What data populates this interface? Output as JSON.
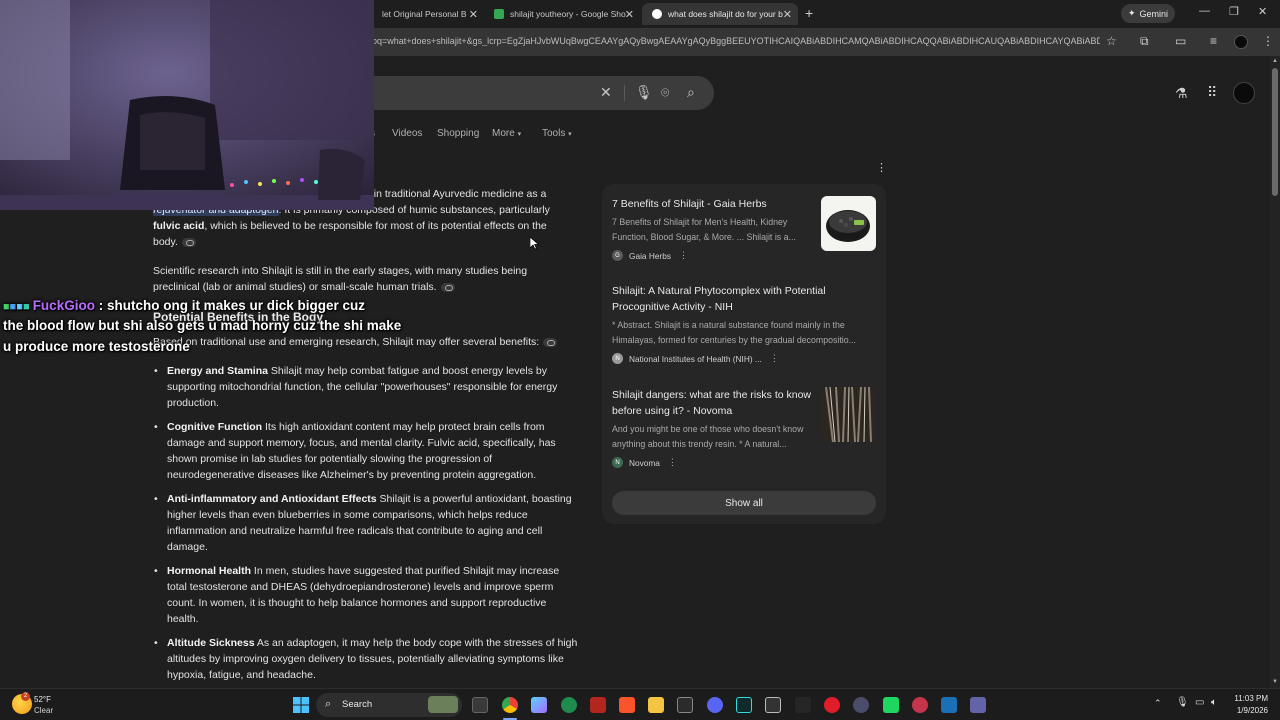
{
  "browser": {
    "tabs": [
      {
        "title": "let Original Personal B",
        "favicon_color": "#4a4a4a"
      },
      {
        "title": "shilajit youtheory - Google Sho",
        "favicon_color": "#34a853"
      },
      {
        "title": "what does shilajit do for your b",
        "favicon_color": "#4285f4"
      }
    ],
    "new_tab_symbol": "+",
    "gemini_label": "Gemini",
    "url": "oq=what+does+shilajit+&gs_lcrp=EgZjaHJvbWUqBwgCEAAYgAQyBwgAEAAYgAQyBggBEEUYOTIHCAIQABiABDIHCAMQABiABDIHCAQQABiABDIHCAUQABiABDIHCAYQABiABD"
  },
  "google": {
    "nav_tabs": [
      "s",
      "Videos",
      "Shopping",
      "More",
      "Tools"
    ]
  },
  "content": {
    "p1_line1": "d in traditional Ayurvedic medicine as a",
    "p1_line2_rest": ". It is primarily composed of humic substances, particularly",
    "p1_line2_hl": "rejuvenator and adaptogen",
    "p1_bold": "fulvic acid",
    "p1_line3_rest": ", which is believed to be responsible for most of its potential effects on the",
    "p1_line4": "body.",
    "p2": "Scientific research into Shilajit is still in the early stages, with many studies being preclinical (lab or animal studies) or small-scale human trials.",
    "heading": "Potential Benefits in the Body",
    "p3": "Based on traditional use and emerging research, Shilajit may offer several benefits:",
    "benefits": [
      {
        "title": "Energy and Stamina",
        "text": " Shilajit may help combat fatigue and boost energy levels by supporting mitochondrial function, the cellular \"powerhouses\" responsible for energy production."
      },
      {
        "title": "Cognitive Function",
        "text": " Its high antioxidant content may help protect brain cells from damage and support memory, focus, and mental clarity. Fulvic acid, specifically, has shown promise in lab studies for potentially slowing the progression of neurodegenerative diseases like Alzheimer's by preventing protein aggregation."
      },
      {
        "title": "Anti-inflammatory and Antioxidant Effects",
        "text": " Shilajit is a powerful antioxidant, boasting higher levels than even blueberries in some comparisons, which helps reduce inflammation and neutralize harmful free radicals that contribute to aging and cell damage."
      },
      {
        "title": "Hormonal Health",
        "text": " In men, studies have suggested that purified Shilajit may increase total testosterone and DHEAS (dehydroepiandrosterone) levels and improve sperm count. In women, it is thought to help balance hormones and support reproductive health."
      },
      {
        "title": "Altitude Sickness",
        "text": " As an adaptogen, it may help the body cope with the stresses of high altitudes by improving oxygen delivery to tissues, potentially alleviating symptoms like hypoxia, fatigue, and headache."
      }
    ]
  },
  "sources": [
    {
      "title": "7 Benefits of Shilajit - Gaia Herbs",
      "snippet_1": "7 Benefits of Shilajit for Men's Health, Kidney",
      "snippet_2": "Function, Blood Sugar, & More. ... Shilajit is a...",
      "source": "Gaia Herbs",
      "source_icon": "G"
    },
    {
      "title_1": "Shilajit: A Natural Phytocomplex with Potential",
      "title_2": "Procognitive Activity - NIH",
      "snippet_1": "* Abstract. Shilajit is a natural substance found mainly in the",
      "snippet_2": "Himalayas, formed for centuries by the gradual decompositio...",
      "source": "National Institutes of Health (NIH) ...",
      "source_icon": "N"
    },
    {
      "title_1": "Shilajit dangers: what are the risks to know",
      "title_2": "before using it? - Novoma",
      "snippet_1": "And you might be one of those who doesn't know",
      "snippet_2": "anything about this trendy resin. * A natural...",
      "source": "Novoma",
      "source_icon": "N"
    }
  ],
  "show_all": "Show all",
  "chat": {
    "username": "FuckGioo",
    "message_1": " : shutcho ong it makes ur dick bigger cuz",
    "message_2": "the blood flow but shi also gets u mad horny cuz the shi make",
    "message_3": "u produce more testosterone",
    "username_color": "#b86cff"
  },
  "taskbar": {
    "weather_temp": "52°F",
    "weather_desc": "Clear",
    "search_label": "Search",
    "time": "11:03 PM",
    "date": "1/9/2026",
    "weather_badge": "2"
  }
}
